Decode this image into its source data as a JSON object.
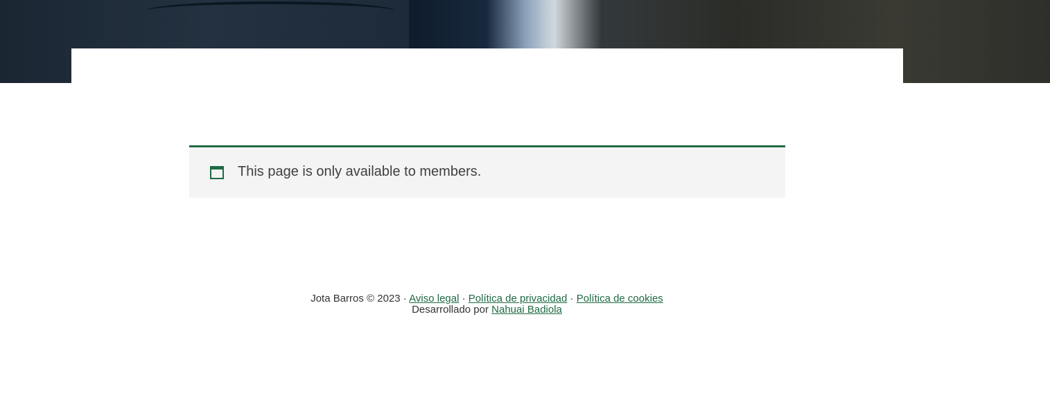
{
  "notice": {
    "message": "This page is only available to members.",
    "icon": "calendar-icon",
    "accent_color": "#1e6a43"
  },
  "footer": {
    "copyright": "Jota Barros © 2023 ·",
    "separator": "·",
    "links": {
      "legal": "Aviso legal",
      "privacy": "Política de privacidad",
      "cookies": "Política de cookies",
      "developer": "Nahuai Badiola"
    },
    "developed_by": "Desarrollado por"
  },
  "colors": {
    "link": "#1e6a43",
    "notice_background": "#f4f4f4",
    "text": "#333333"
  }
}
